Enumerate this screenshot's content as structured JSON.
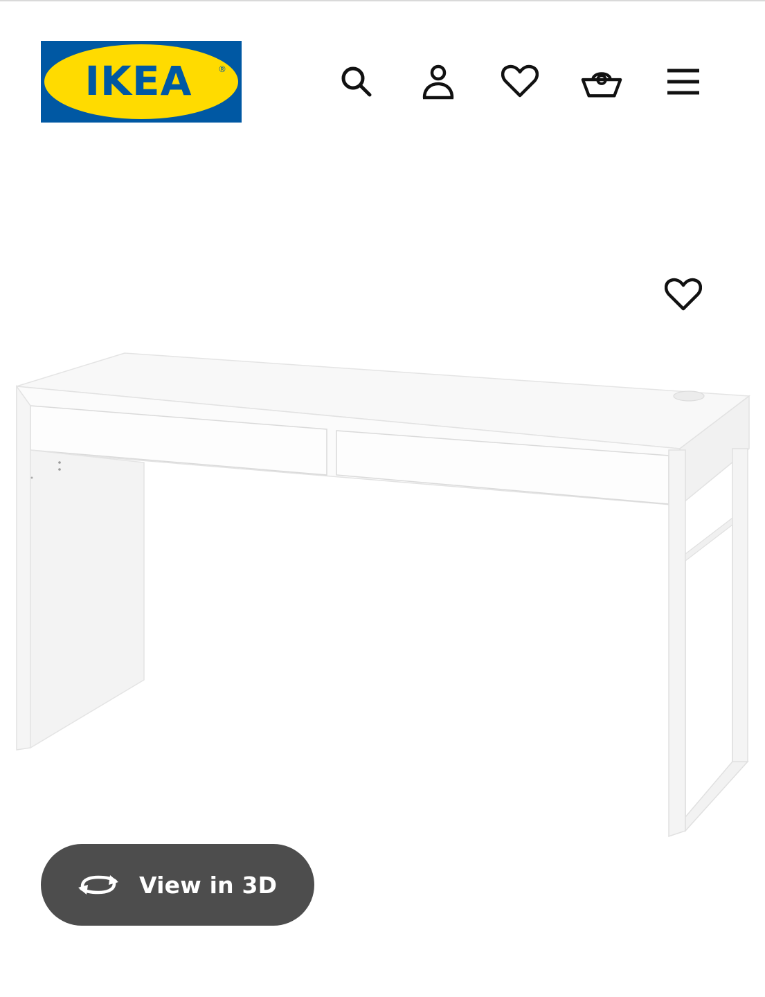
{
  "header": {
    "logo": {
      "text": "IKEA",
      "registered_mark": "®",
      "background_color": "#0058a3",
      "oval_color": "#ffdb00",
      "text_color": "#0058a3"
    },
    "icons": [
      "search-icon",
      "account-icon",
      "heart-icon",
      "basket-icon",
      "menu-icon"
    ]
  },
  "product": {
    "favourite_icon": "heart-icon",
    "image_icon": "desk-image"
  },
  "view_3d": {
    "label": "View in 3D",
    "icon": "rotate-3d-icon",
    "background_color": "#4d4d4d",
    "text_color": "#ffffff"
  }
}
